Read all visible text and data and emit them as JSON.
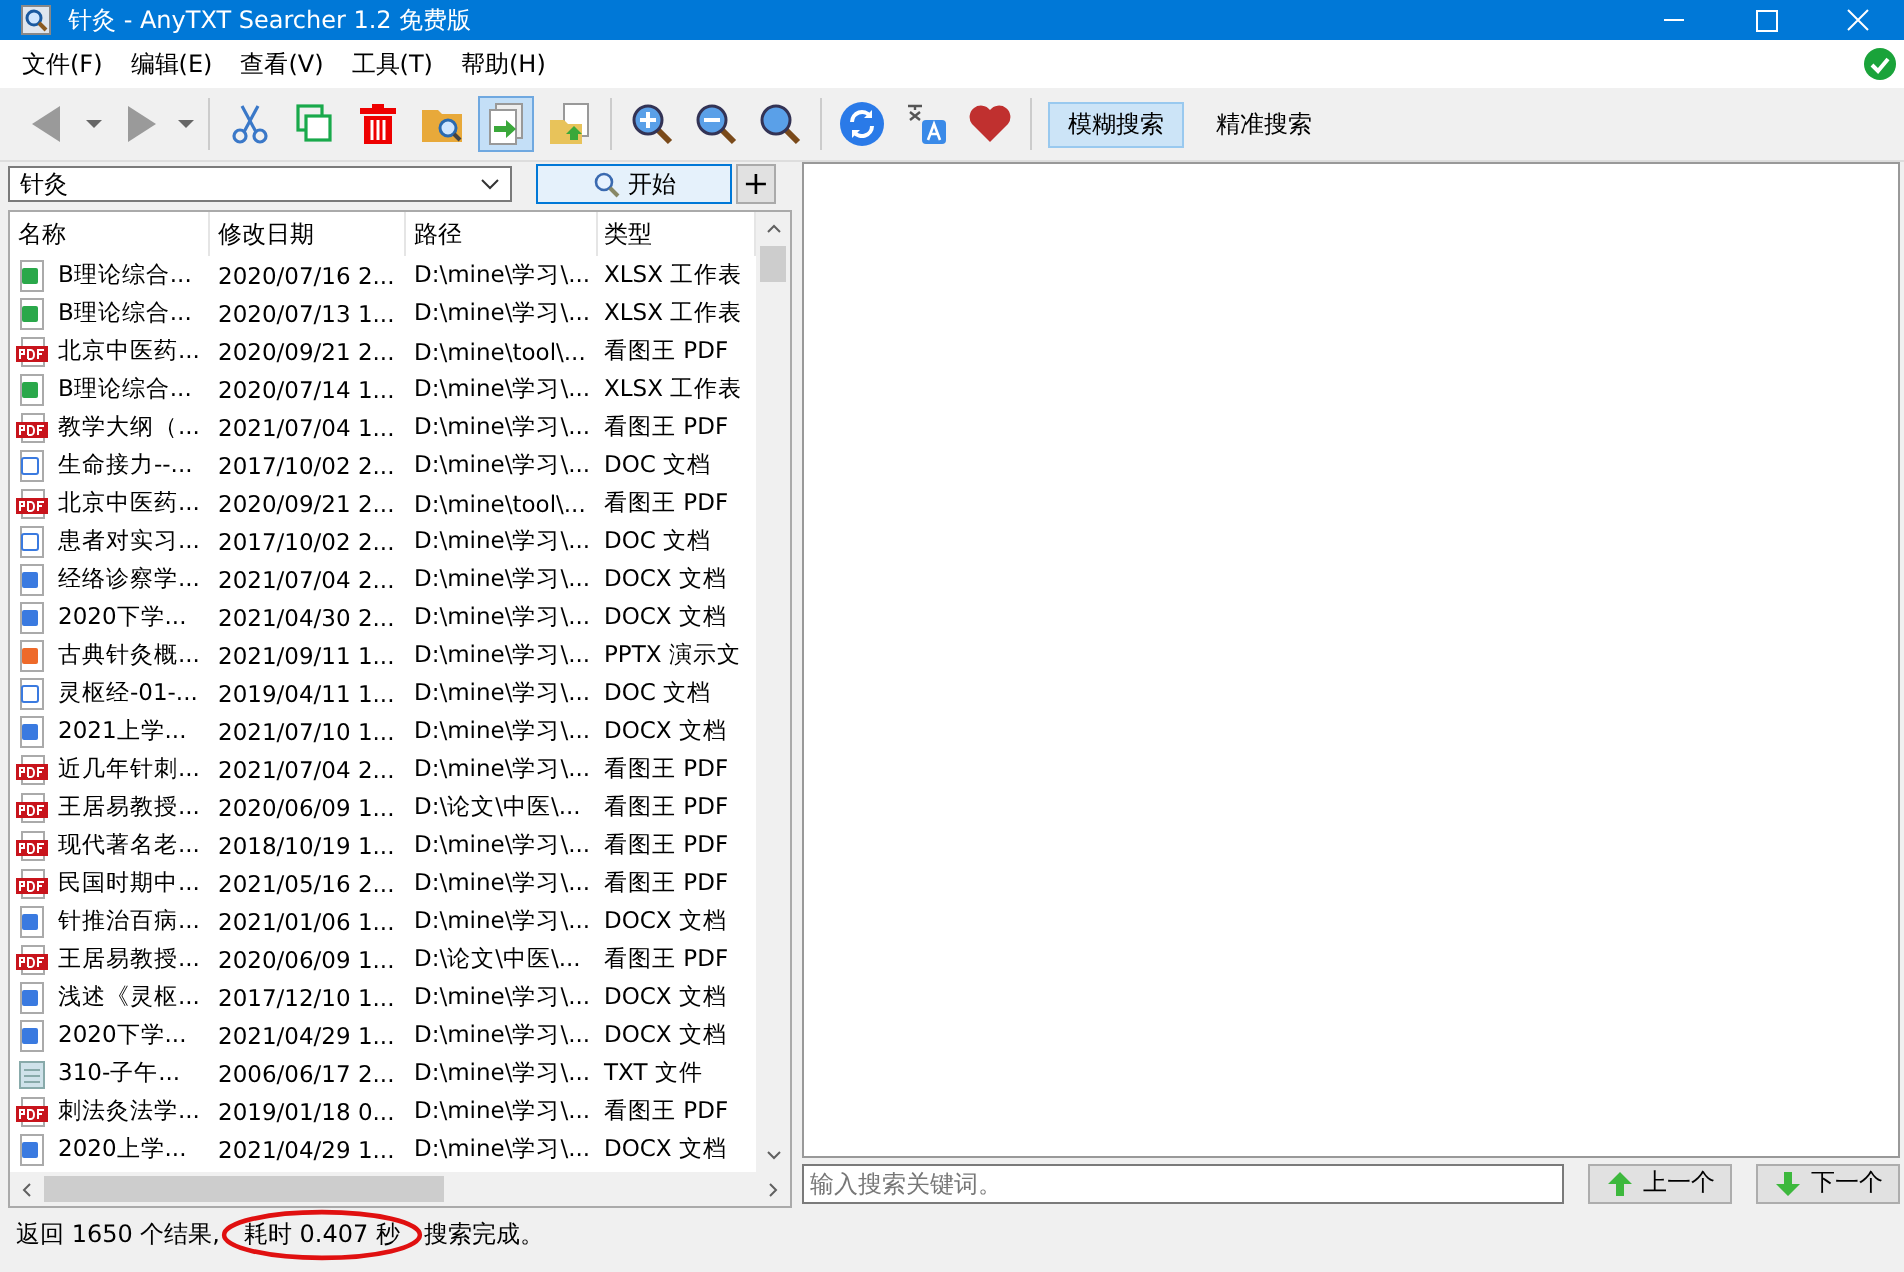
{
  "window": {
    "title": "针灸 - AnyTXT Searcher 1.2 免费版"
  },
  "menu": [
    "文件(F)",
    "编辑(E)",
    "查看(V)",
    "工具(T)",
    "帮助(H)"
  ],
  "toolbar": [
    {
      "items": [
        {
          "kind": "back",
          "selected": false
        },
        {
          "kind": "dropdown",
          "selected": false
        },
        {
          "kind": "forward",
          "selected": false
        },
        {
          "kind": "dropdown",
          "selected": false
        }
      ]
    },
    {
      "items": [
        {
          "kind": "cut",
          "selected": false
        },
        {
          "kind": "copy",
          "selected": false
        },
        {
          "kind": "delete",
          "selected": false
        },
        {
          "kind": "folder",
          "selected": false
        },
        {
          "kind": "export",
          "selected": true
        },
        {
          "kind": "import",
          "selected": false
        }
      ]
    },
    {
      "items": [
        {
          "kind": "zoomin",
          "selected": false
        },
        {
          "kind": "zoomout",
          "selected": false
        },
        {
          "kind": "zoom",
          "selected": false
        }
      ]
    },
    {
      "items": [
        {
          "kind": "refresh",
          "selected": false
        },
        {
          "kind": "translate",
          "selected": false
        },
        {
          "kind": "heart",
          "selected": false
        }
      ]
    }
  ],
  "search_modes": [
    {
      "label": "模糊搜索",
      "selected": true
    },
    {
      "label": "精准搜索",
      "selected": false
    }
  ],
  "search": {
    "value": "针灸",
    "button": "开始",
    "add": "+"
  },
  "table": {
    "columns": [
      "名称",
      "修改日期",
      "路径",
      "类型"
    ],
    "rows": [
      {
        "kind": "xlsx",
        "name": "B理论综合...",
        "date": "2020/07/16  2...",
        "path": "D:\\mine\\学习\\...",
        "type": "XLSX 工作表"
      },
      {
        "kind": "xlsx",
        "name": "B理论综合...",
        "date": "2020/07/13  1...",
        "path": "D:\\mine\\学习\\...",
        "type": "XLSX 工作表"
      },
      {
        "kind": "pdf",
        "name": "北京中医药...",
        "date": "2020/09/21  2...",
        "path": "D:\\mine\\tool\\...",
        "type": "看图王 PDF"
      },
      {
        "kind": "xlsx",
        "name": "B理论综合...",
        "date": "2020/07/14  1...",
        "path": "D:\\mine\\学习\\...",
        "type": "XLSX 工作表"
      },
      {
        "kind": "pdf",
        "name": "教学大纲（...",
        "date": "2021/07/04  1...",
        "path": "D:\\mine\\学习\\...",
        "type": "看图王 PDF"
      },
      {
        "kind": "doc",
        "name": "生命接力--...",
        "date": "2017/10/02  2...",
        "path": "D:\\mine\\学习\\...",
        "type": "DOC 文档"
      },
      {
        "kind": "pdf",
        "name": "北京中医药...",
        "date": "2020/09/21  2...",
        "path": "D:\\mine\\tool\\...",
        "type": "看图王 PDF"
      },
      {
        "kind": "doc",
        "name": "患者对实习...",
        "date": "2017/10/02  2...",
        "path": "D:\\mine\\学习\\...",
        "type": "DOC 文档"
      },
      {
        "kind": "docx",
        "name": "经络诊察学...",
        "date": "2021/07/04  2...",
        "path": "D:\\mine\\学习\\...",
        "type": "DOCX 文档"
      },
      {
        "kind": "docx",
        "name": "2020下学...",
        "date": "2021/04/30  2...",
        "path": "D:\\mine\\学习\\...",
        "type": "DOCX 文档"
      },
      {
        "kind": "pptx",
        "name": "古典针灸概...",
        "date": "2021/09/11  1...",
        "path": "D:\\mine\\学习\\...",
        "type": "PPTX 演示文"
      },
      {
        "kind": "doc",
        "name": "灵枢经-01-...",
        "date": "2019/04/11  1...",
        "path": "D:\\mine\\学习\\...",
        "type": "DOC 文档"
      },
      {
        "kind": "docx",
        "name": "2021上学...",
        "date": "2021/07/10  1...",
        "path": "D:\\mine\\学习\\...",
        "type": "DOCX 文档"
      },
      {
        "kind": "pdf",
        "name": "近几年针刺...",
        "date": "2021/07/04  2...",
        "path": "D:\\mine\\学习\\...",
        "type": "看图王 PDF"
      },
      {
        "kind": "pdf",
        "name": "王居易教授...",
        "date": "2020/06/09  1...",
        "path": "D:\\论文\\中医\\...",
        "type": "看图王 PDF"
      },
      {
        "kind": "pdf",
        "name": "现代著名老...",
        "date": "2018/10/19  1...",
        "path": "D:\\mine\\学习\\...",
        "type": "看图王 PDF"
      },
      {
        "kind": "pdf",
        "name": "民国时期中...",
        "date": "2021/05/16  2...",
        "path": "D:\\mine\\学习\\...",
        "type": "看图王 PDF"
      },
      {
        "kind": "docx",
        "name": "针推治百病...",
        "date": "2021/01/06  1...",
        "path": "D:\\mine\\学习\\...",
        "type": "DOCX 文档"
      },
      {
        "kind": "pdf",
        "name": "王居易教授...",
        "date": "2020/06/09  1...",
        "path": "D:\\论文\\中医\\...",
        "type": "看图王 PDF"
      },
      {
        "kind": "docx",
        "name": "浅述《灵枢...",
        "date": "2017/12/10  1...",
        "path": "D:\\mine\\学习\\...",
        "type": "DOCX 文档"
      },
      {
        "kind": "docx",
        "name": "2020下学...",
        "date": "2021/04/29  1...",
        "path": "D:\\mine\\学习\\...",
        "type": "DOCX 文档"
      },
      {
        "kind": "txt",
        "name": "310-子午...",
        "date": "2006/06/17  2...",
        "path": "D:\\mine\\学习\\...",
        "type": "TXT 文件"
      },
      {
        "kind": "pdf",
        "name": "刺法灸法学...",
        "date": "2019/01/18  0...",
        "path": "D:\\mine\\学习\\...",
        "type": "看图王 PDF"
      },
      {
        "kind": "docx",
        "name": "2020上学...",
        "date": "2021/04/29  1...",
        "path": "D:\\mine\\学习\\...",
        "type": "DOCX 文档"
      }
    ]
  },
  "preview": {
    "find_placeholder": "输入搜索关键词。",
    "prev": "上一个",
    "next": "下一个"
  },
  "status_bar": {
    "count": "返回 1650 个结果,",
    "elapsed": "耗时 0.407 秒",
    "message": "搜索完成。",
    "elapsed_circled": true
  }
}
